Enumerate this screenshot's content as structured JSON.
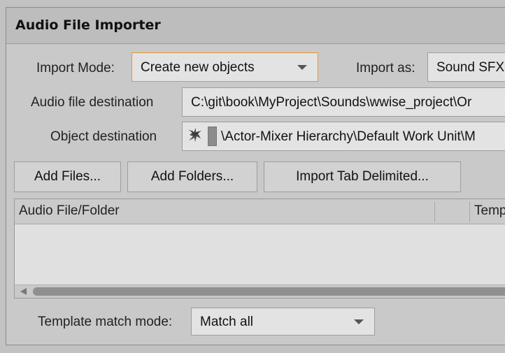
{
  "window": {
    "title": "Audio File Importer"
  },
  "import_mode": {
    "label": "Import Mode:",
    "value": "Create new objects"
  },
  "import_as": {
    "label": "Import as:",
    "value": "Sound SFX"
  },
  "audio_dest": {
    "label": "Audio file destination",
    "value": "C:\\git\\book\\MyProject\\Sounds\\wwise_project\\Or"
  },
  "object_dest": {
    "label": "Object destination",
    "value": "\\Actor-Mixer Hierarchy\\Default Work Unit\\M",
    "icon": "wwise-object-icon"
  },
  "buttons": {
    "add_files": "Add Files...",
    "add_folders": "Add Folders...",
    "import_tab": "Import Tab Delimited..."
  },
  "file_list": {
    "columns": [
      "Audio File/Folder",
      "",
      "Temp"
    ]
  },
  "template_match": {
    "label": "Template match mode:",
    "value": "Match all"
  }
}
